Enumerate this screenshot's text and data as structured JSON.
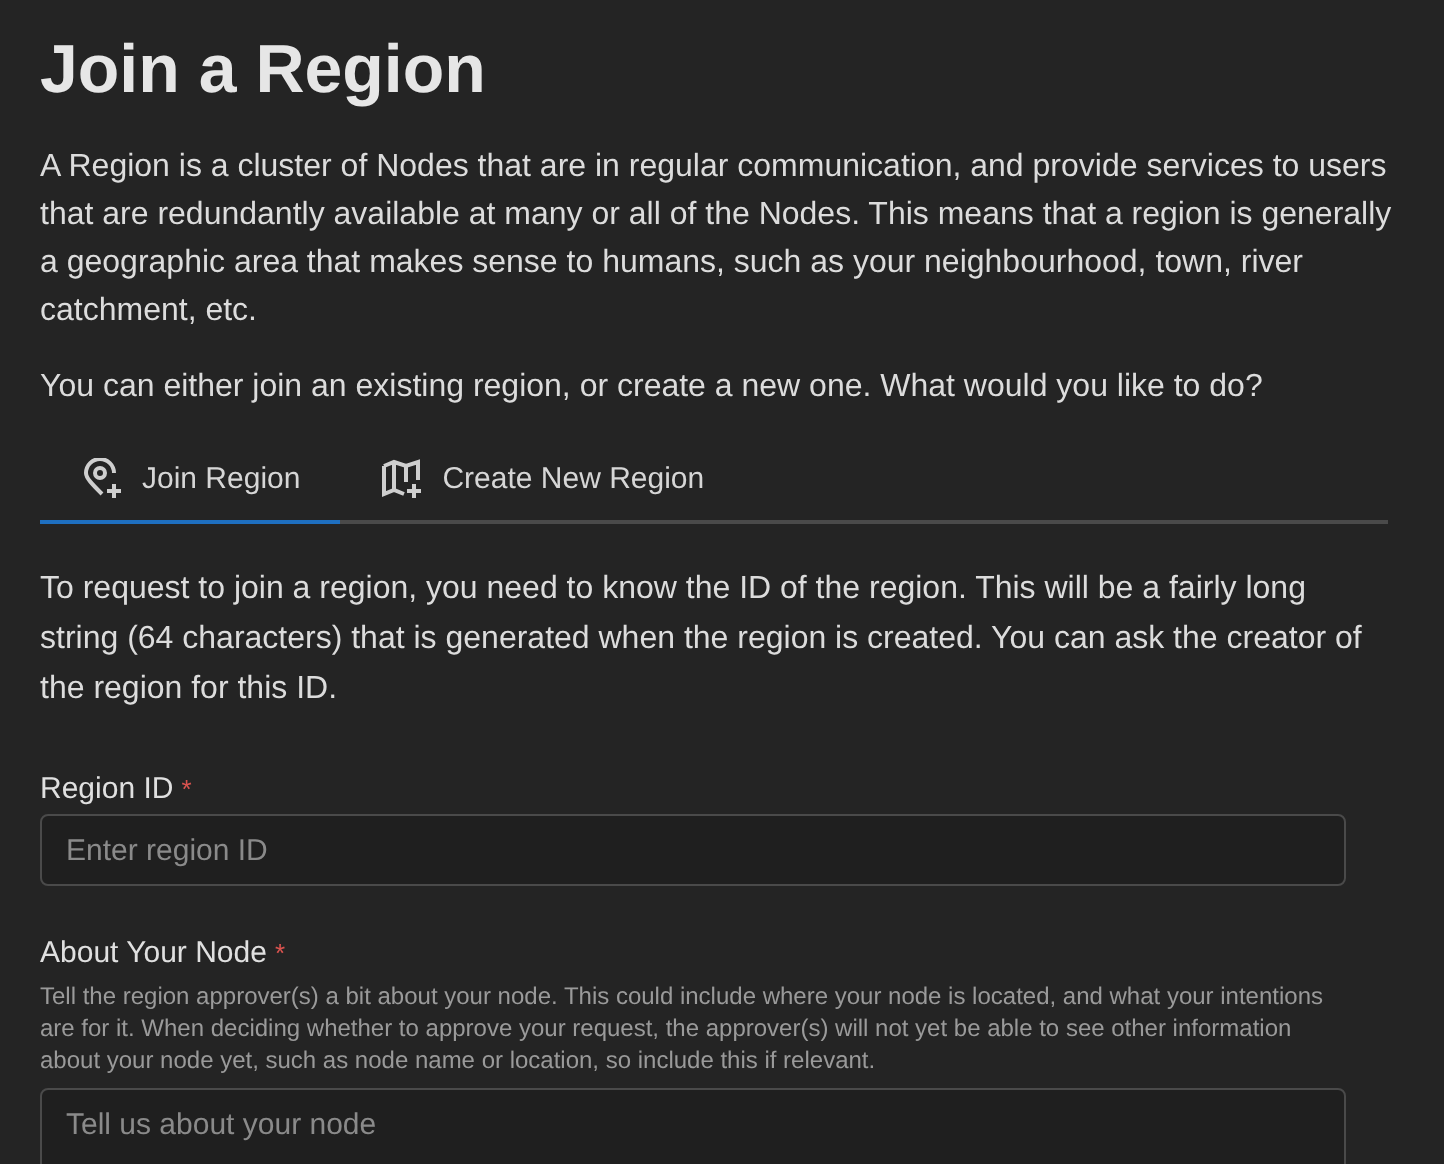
{
  "title": "Join a Region",
  "intro": [
    "A Region is a cluster of Nodes that are in regular communication, and provide services to users that are redundantly available at many or all of the Nodes. This means that a region is generally a geographic area that makes sense to humans, such as your neighbourhood, town, river catchment, etc.",
    "You can either join an existing region, or create a new one. What would you like to do?"
  ],
  "tabs": [
    {
      "label": "Join Region",
      "kind": "pin",
      "selected": true
    },
    {
      "label": "Create New Region",
      "kind": "map",
      "selected": false
    }
  ],
  "tab_text": "To request to join a region, you need to know the ID of the region. This will be a fairly long string (64 characters) that is generated when the region is created. You can ask the creator of the region for this ID.",
  "fields": [
    {
      "label": "Region ID",
      "required_mark": "*",
      "kind": "input",
      "placeholder": "Enter region ID"
    },
    {
      "label": "About Your Node",
      "required_mark": "*",
      "kind": "textarea",
      "help": "Tell the region approver(s) a bit about your node. This could include where your node is located, and what your intentions are for it. When deciding whether to approve your request, the approver(s) will not yet be able to see other information about your node yet, such as node name or location, so include this if relevant.",
      "placeholder": "Tell us about your node"
    }
  ]
}
